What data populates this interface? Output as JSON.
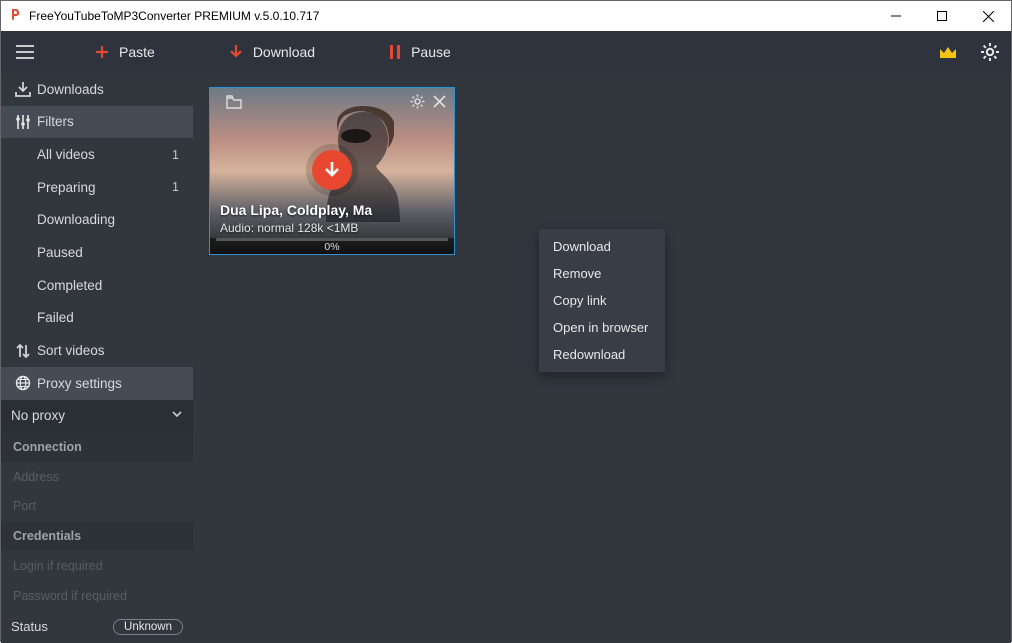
{
  "window": {
    "title": "FreeYouTubeToMP3Converter PREMIUM  v.5.0.10.717"
  },
  "toolbar": {
    "paste": "Paste",
    "download": "Download",
    "pause": "Pause"
  },
  "sidebar": {
    "downloads": "Downloads",
    "filters": "Filters",
    "filter_items": [
      {
        "label": "All videos",
        "count": "1"
      },
      {
        "label": "Preparing",
        "count": "1"
      },
      {
        "label": "Downloading",
        "count": ""
      },
      {
        "label": "Paused",
        "count": ""
      },
      {
        "label": "Completed",
        "count": ""
      },
      {
        "label": "Failed",
        "count": ""
      }
    ],
    "sort": "Sort videos",
    "proxy": "Proxy settings",
    "proxy_value": "No proxy",
    "connection_header": "Connection",
    "address_placeholder": "Address",
    "port_placeholder": "Port",
    "credentials_header": "Credentials",
    "login_placeholder": "Login if required",
    "password_placeholder": "Password if required",
    "status_label": "Status",
    "status_value": "Unknown"
  },
  "card": {
    "title": "Dua Lipa, Coldplay, Ma",
    "subtitle": "Audio:  normal 128k  <1MB",
    "progress_pct": "0%"
  },
  "context_menu": {
    "items": [
      "Download",
      "Remove",
      "Copy link",
      "Open in browser",
      "Redownload"
    ]
  },
  "colors": {
    "accent_red": "#e8482f",
    "crown": "#f3c413"
  }
}
